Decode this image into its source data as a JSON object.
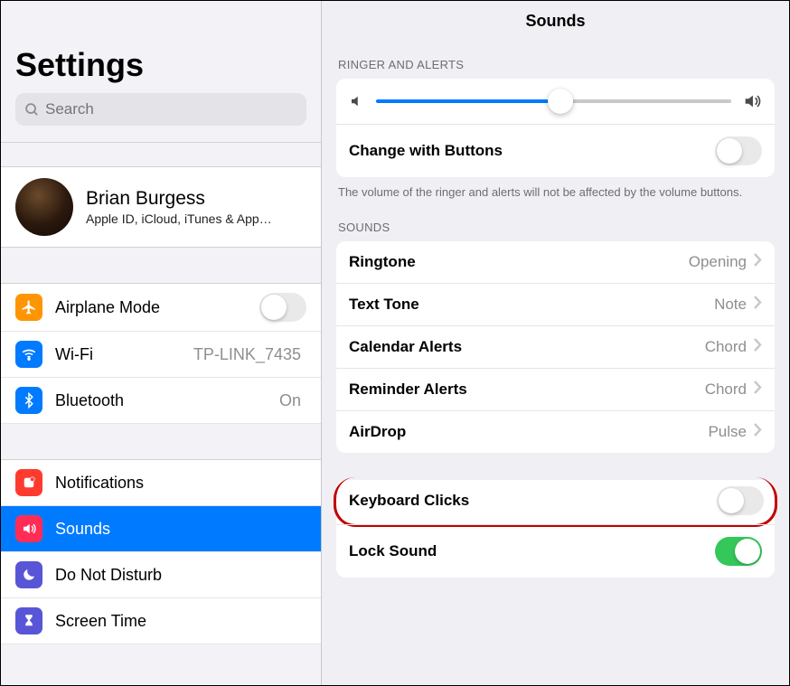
{
  "sidebar": {
    "title": "Settings",
    "search_placeholder": "Search",
    "profile": {
      "name": "Brian Burgess",
      "subtitle": "Apple ID, iCloud, iTunes & App…"
    },
    "group1": [
      {
        "key": "airplane",
        "label": "Airplane Mode",
        "toggle": false
      },
      {
        "key": "wifi",
        "label": "Wi-Fi",
        "value": "TP-LINK_7435"
      },
      {
        "key": "bluetooth",
        "label": "Bluetooth",
        "value": "On"
      }
    ],
    "group2": [
      {
        "key": "notifications",
        "label": "Notifications"
      },
      {
        "key": "sounds",
        "label": "Sounds",
        "selected": true
      },
      {
        "key": "dnd",
        "label": "Do Not Disturb"
      },
      {
        "key": "screentime",
        "label": "Screen Time"
      }
    ]
  },
  "content": {
    "title": "Sounds",
    "ringer_section": "RINGER AND ALERTS",
    "slider_value": 52,
    "change_with_buttons": {
      "label": "Change with Buttons",
      "on": false
    },
    "footnote": "The volume of the ringer and alerts will not be affected by the volume buttons.",
    "sounds_section": "SOUNDS",
    "sounds": [
      {
        "label": "Ringtone",
        "value": "Opening"
      },
      {
        "label": "Text Tone",
        "value": "Note"
      },
      {
        "label": "Calendar Alerts",
        "value": "Chord"
      },
      {
        "label": "Reminder Alerts",
        "value": "Chord"
      },
      {
        "label": "AirDrop",
        "value": "Pulse"
      }
    ],
    "extra": [
      {
        "label": "Keyboard Clicks",
        "on": false,
        "highlight": true
      },
      {
        "label": "Lock Sound",
        "on": true
      }
    ]
  }
}
